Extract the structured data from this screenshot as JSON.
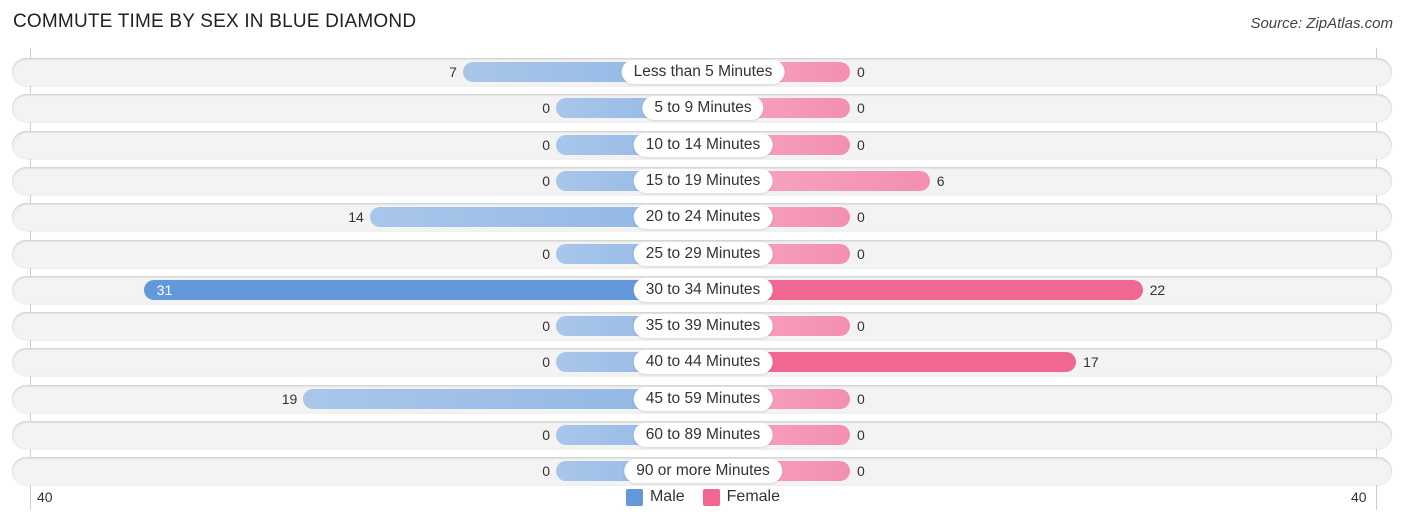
{
  "header": {
    "title": "COMMUTE TIME BY SEX IN BLUE DIAMOND",
    "source": "Source: ZipAtlas.com"
  },
  "colors": {
    "male": "#6399da",
    "female": "#f06891",
    "male_light": "#a9c6ea",
    "female_light": "#f7a8c0"
  },
  "chart_data": {
    "type": "bar",
    "orientation": "horizontal-diverging",
    "title": "COMMUTE TIME BY SEX IN BLUE DIAMOND",
    "categories": [
      "Less than 5 Minutes",
      "5 to 9 Minutes",
      "10 to 14 Minutes",
      "15 to 19 Minutes",
      "20 to 24 Minutes",
      "25 to 29 Minutes",
      "30 to 34 Minutes",
      "35 to 39 Minutes",
      "40 to 44 Minutes",
      "45 to 59 Minutes",
      "60 to 89 Minutes",
      "90 or more Minutes"
    ],
    "series": [
      {
        "name": "Male",
        "side": "left",
        "values": [
          7,
          0,
          0,
          0,
          14,
          0,
          31,
          0,
          0,
          19,
          0,
          0
        ]
      },
      {
        "name": "Female",
        "side": "right",
        "values": [
          0,
          0,
          0,
          6,
          0,
          0,
          22,
          0,
          17,
          0,
          0,
          0
        ]
      }
    ],
    "axis": {
      "left_tick": "40",
      "right_tick": "40",
      "range": [
        -40,
        40
      ]
    },
    "legend": {
      "position": "bottom-center",
      "entries": [
        "Male",
        "Female"
      ]
    },
    "grid": false
  }
}
